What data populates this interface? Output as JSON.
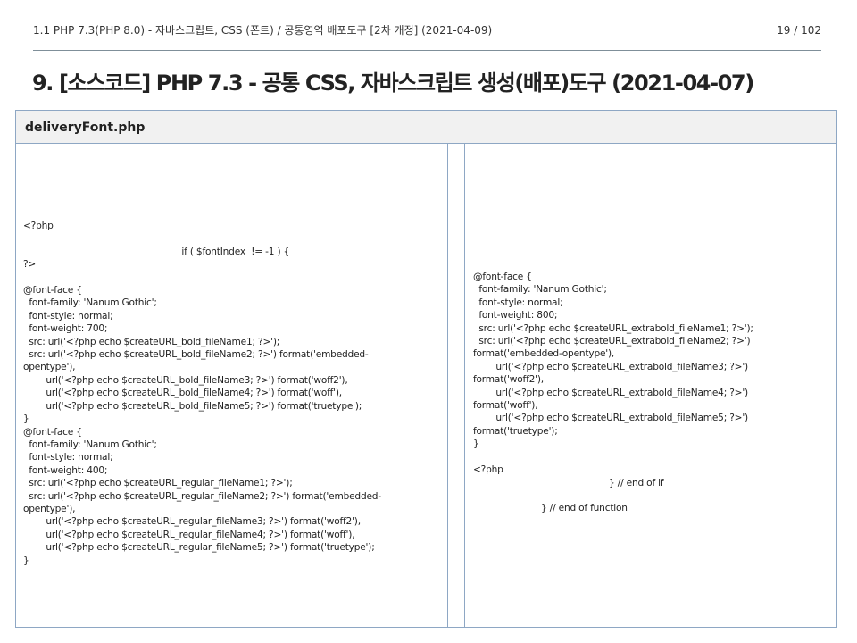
{
  "header": {
    "title": "1.1 PHP 7.3(PHP 8.0) - 자바스크립트, CSS (폰트) / 공통영역 배포도구 [2차 개정] (2021-04-09)",
    "pager": "19 / 102"
  },
  "heading": "9. [소스코드] PHP 7.3 - 공통 CSS, 자바스크립트 생성(배포)도구 (2021-04-07)",
  "file": {
    "name": "deliveryFont.php"
  },
  "code": {
    "left": "<?php\n\n                                                        if ( $fontIndex  != -1 ) {\n?>\n\n@font-face {\n  font-family: 'Nanum Gothic';\n  font-style: normal;\n  font-weight: 700;\n  src: url('<?php echo $createURL_bold_fileName1; ?>');\n  src: url('<?php echo $createURL_bold_fileName2; ?>') format('embedded-\nopentype'),\n        url('<?php echo $createURL_bold_fileName3; ?>') format('woff2'),\n        url('<?php echo $createURL_bold_fileName4; ?>') format('woff'),\n        url('<?php echo $createURL_bold_fileName5; ?>') format('truetype');\n}\n@font-face {\n  font-family: 'Nanum Gothic';\n  font-style: normal;\n  font-weight: 400;\n  src: url('<?php echo $createURL_regular_fileName1; ?>');\n  src: url('<?php echo $createURL_regular_fileName2; ?>') format('embedded-\nopentype'),\n        url('<?php echo $createURL_regular_fileName3; ?>') format('woff2'),\n        url('<?php echo $createURL_regular_fileName4; ?>') format('woff'),\n        url('<?php echo $createURL_regular_fileName5; ?>') format('truetype');\n}",
    "right": "@font-face {\n  font-family: 'Nanum Gothic';\n  font-style: normal;\n  font-weight: 800;\n  src: url('<?php echo $createURL_extrabold_fileName1; ?>');\n  src: url('<?php echo $createURL_extrabold_fileName2; ?>')\nformat('embedded-opentype'),\n        url('<?php echo $createURL_extrabold_fileName3; ?>')\nformat('woff2'),\n        url('<?php echo $createURL_extrabold_fileName4; ?>')\nformat('woff'),\n        url('<?php echo $createURL_extrabold_fileName5; ?>')\nformat('truetype');\n}\n\n<?php\n                                                } // end of if\n\n                        } // end of function"
  }
}
